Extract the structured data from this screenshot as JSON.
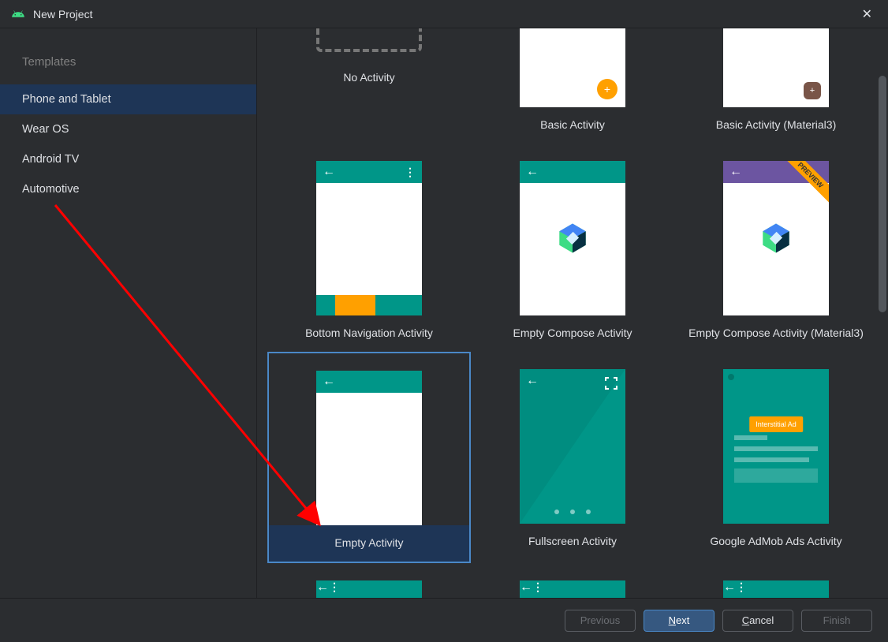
{
  "window": {
    "title": "New Project"
  },
  "sidebar": {
    "header": "Templates",
    "items": [
      {
        "label": "Phone and Tablet",
        "selected": true
      },
      {
        "label": "Wear OS",
        "selected": false
      },
      {
        "label": "Android TV",
        "selected": false
      },
      {
        "label": "Automotive",
        "selected": false
      }
    ]
  },
  "templates": {
    "row0": [
      {
        "label": "No Activity"
      },
      {
        "label": "Basic Activity"
      },
      {
        "label": "Basic Activity (Material3)"
      }
    ],
    "row1": [
      {
        "label": "Bottom Navigation Activity"
      },
      {
        "label": "Empty Compose Activity"
      },
      {
        "label": "Empty Compose Activity (Material3)",
        "previewRibbon": "PREVIEW"
      }
    ],
    "row2": [
      {
        "label": "Empty Activity",
        "selected": true
      },
      {
        "label": "Fullscreen Activity"
      },
      {
        "label": "Google AdMob Ads Activity",
        "admobButton": "Interstitial Ad"
      }
    ]
  },
  "footer": {
    "previous": "Previous",
    "next": "Next",
    "cancel": "Cancel",
    "finish": "Finish"
  },
  "colors": {
    "teal": "#009688",
    "orange": "#ffa000",
    "purple": "#6c55a1",
    "brown": "#795548",
    "selection": "#1e3556"
  }
}
